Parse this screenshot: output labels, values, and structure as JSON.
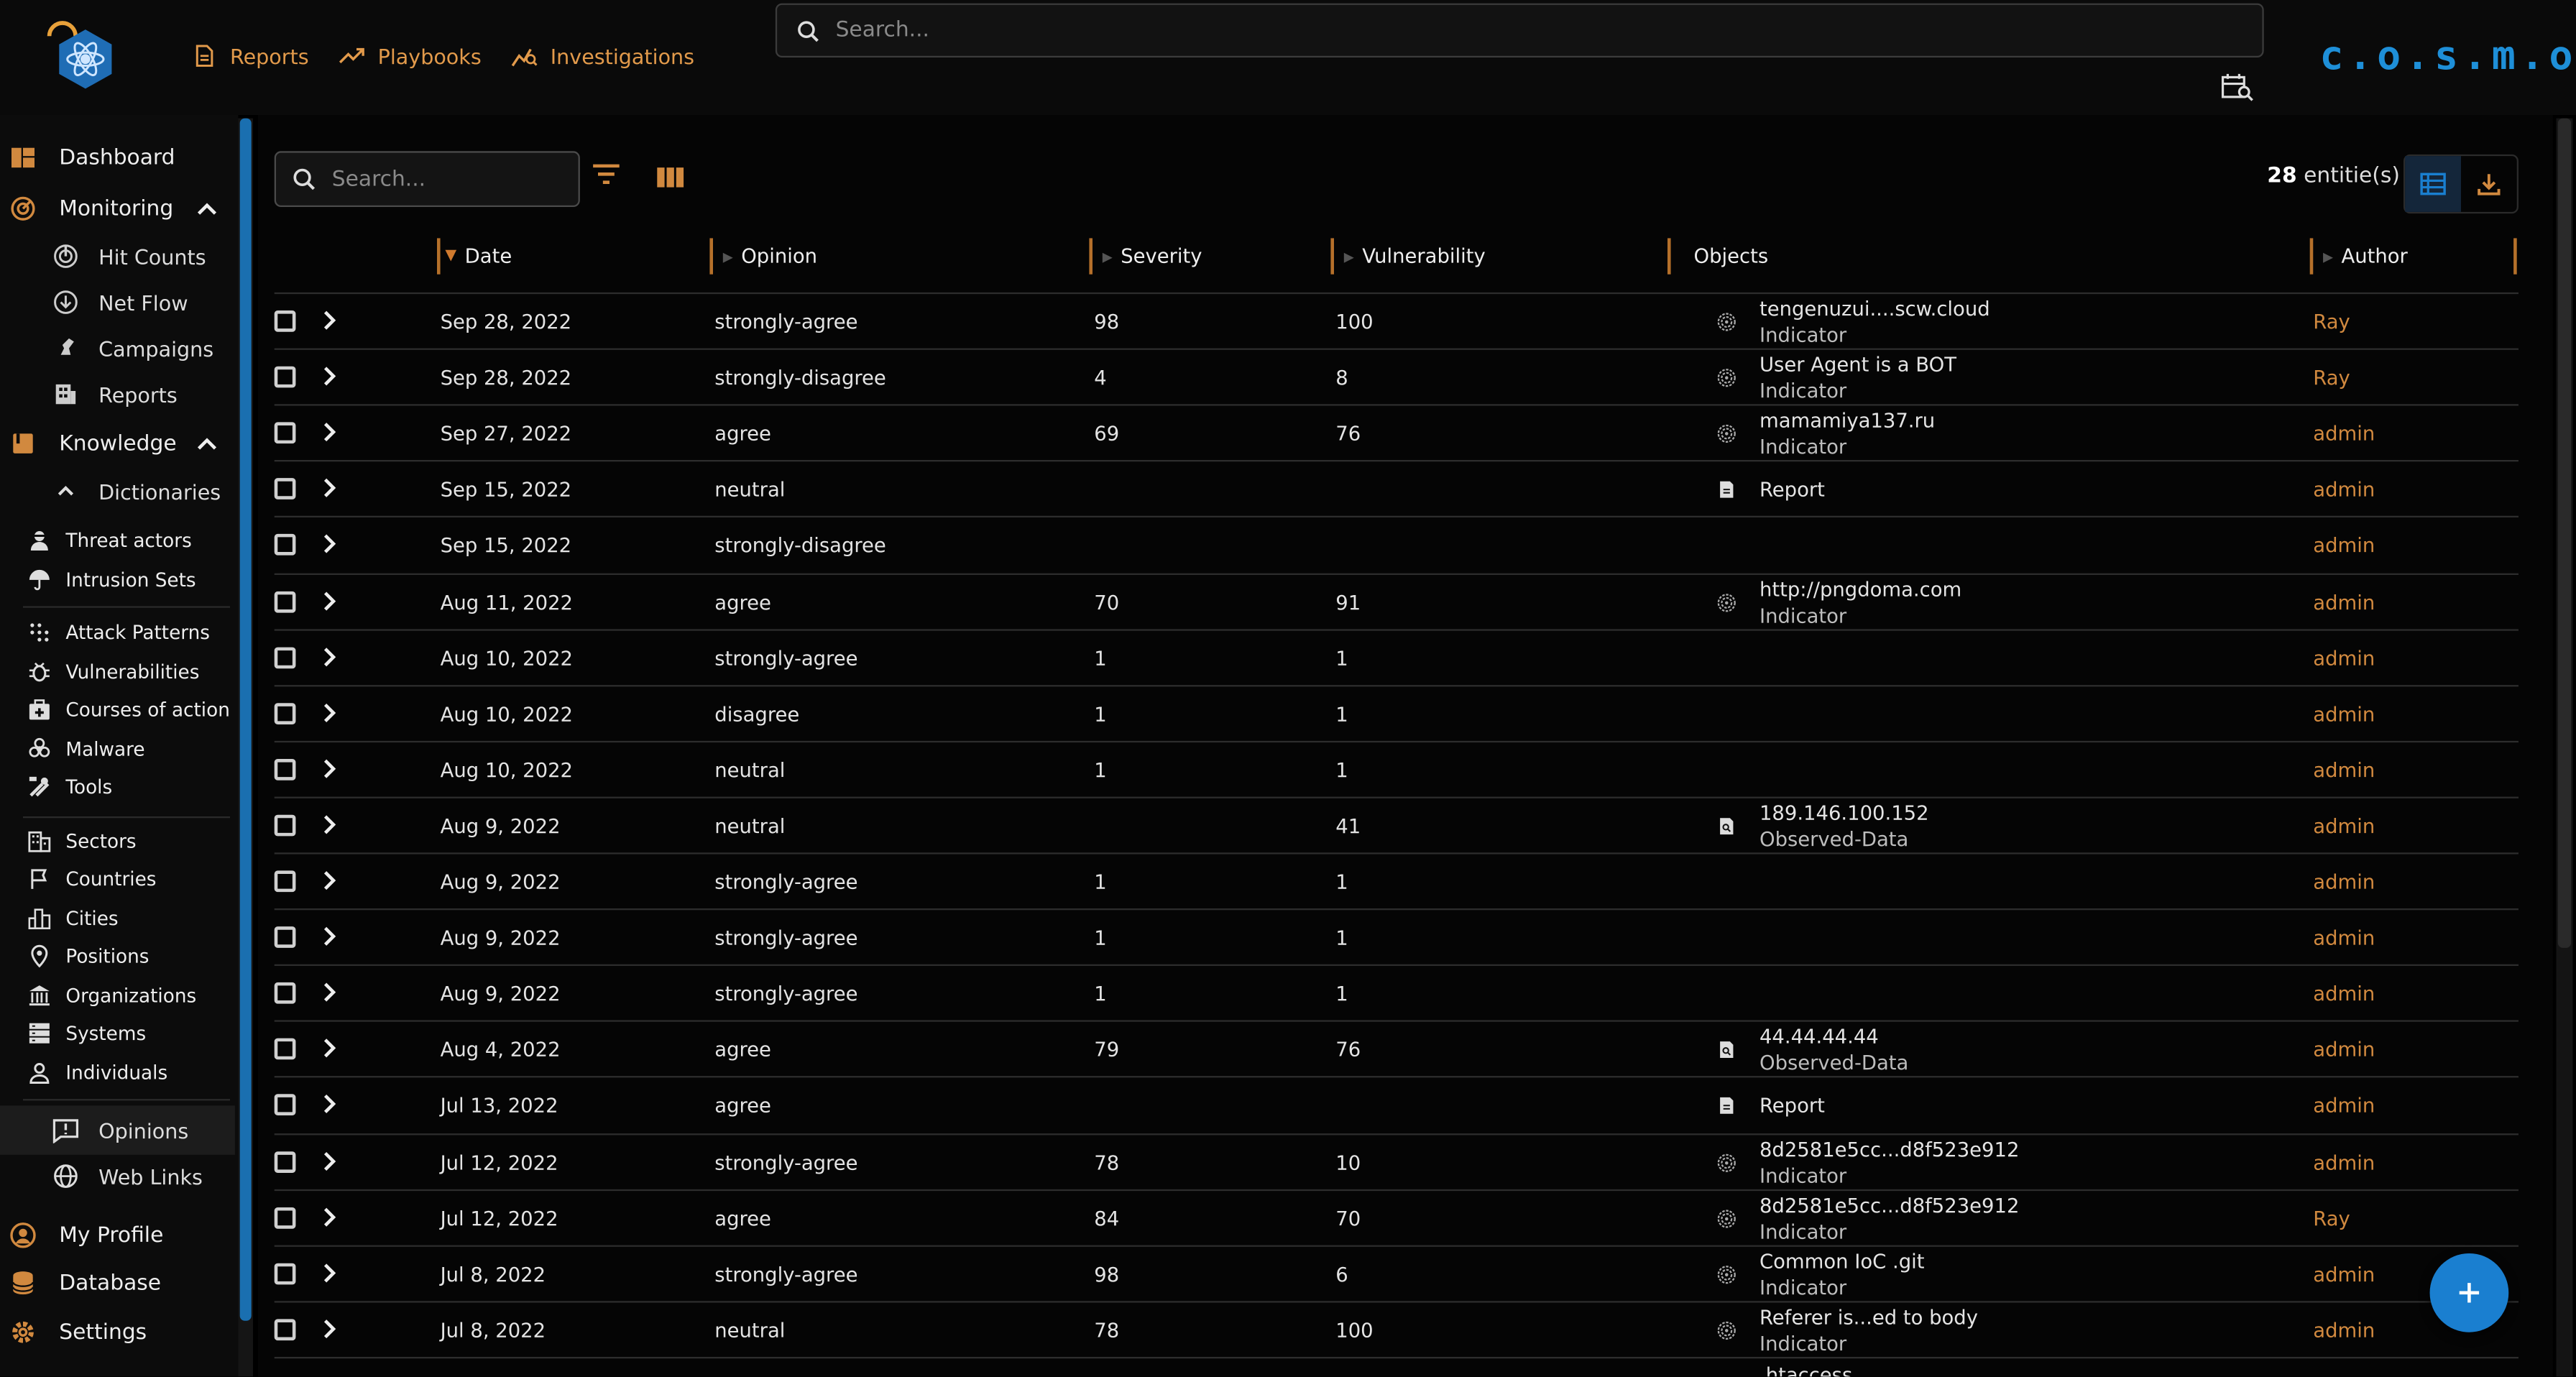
{
  "app": {
    "brand": "c.o.s.m.o",
    "top_nav": [
      {
        "label": "Reports",
        "icon": "file-icon"
      },
      {
        "label": "Playbooks",
        "icon": "trending-icon"
      },
      {
        "label": "Investigations",
        "icon": "investigation-icon"
      }
    ],
    "search_placeholder": "Search..."
  },
  "sidebar": {
    "dashboard": "Dashboard",
    "monitoring": "Monitoring",
    "hit_counts": "Hit Counts",
    "net_flow": "Net Flow",
    "campaigns": "Campaigns",
    "reports": "Reports",
    "knowledge": "Knowledge",
    "dictionaries": "Dictionaries",
    "threat_actors": "Threat actors",
    "intrusion_sets": "Intrusion Sets",
    "attack_patterns": "Attack Patterns",
    "vulnerabilities": "Vulnerabilities",
    "courses_of_action": "Courses of action",
    "malware": "Malware",
    "tools": "Tools",
    "sectors": "Sectors",
    "countries": "Countries",
    "cities": "Cities",
    "positions": "Positions",
    "organizations": "Organizations",
    "systems": "Systems",
    "individuals": "Individuals",
    "opinions": "Opinions",
    "web_links": "Web Links",
    "my_profile": "My Profile",
    "database": "Database",
    "settings": "Settings"
  },
  "toolbar": {
    "search_placeholder": "Search...",
    "count_number": "28",
    "count_suffix": "entitie(s)"
  },
  "columns": {
    "date": "Date",
    "opinion": "Opinion",
    "severity": "Severity",
    "vulnerability": "Vulnerability",
    "objects": "Objects",
    "author": "Author"
  },
  "colors": {
    "accent_orange": "#d1893f",
    "accent_blue": "#1a7fd0"
  },
  "rows": [
    {
      "date": "Sep 28, 2022",
      "opinion": "strongly-agree",
      "severity": "98",
      "vulnerability": "100",
      "obj_icon": "indicator",
      "obj_name": "tengenuzui....scw.cloud",
      "obj_type": "Indicator",
      "author": "Ray"
    },
    {
      "date": "Sep 28, 2022",
      "opinion": "strongly-disagree",
      "severity": "4",
      "vulnerability": "8",
      "obj_icon": "indicator",
      "obj_name": "User Agent is a BOT",
      "obj_type": "Indicator",
      "author": "Ray"
    },
    {
      "date": "Sep 27, 2022",
      "opinion": "agree",
      "severity": "69",
      "vulnerability": "76",
      "obj_icon": "indicator",
      "obj_name": "mamamiya137.ru",
      "obj_type": "Indicator",
      "author": "admin"
    },
    {
      "date": "Sep 15, 2022",
      "opinion": "neutral",
      "severity": "",
      "vulnerability": "",
      "obj_icon": "report",
      "obj_name": "Report",
      "obj_type": "",
      "author": "admin"
    },
    {
      "date": "Sep 15, 2022",
      "opinion": "strongly-disagree",
      "severity": "",
      "vulnerability": "",
      "obj_icon": "",
      "obj_name": "",
      "obj_type": "",
      "author": "admin"
    },
    {
      "date": "Aug 11, 2022",
      "opinion": "agree",
      "severity": "70",
      "vulnerability": "91",
      "obj_icon": "indicator",
      "obj_name": "http://pngdoma.com",
      "obj_type": "Indicator",
      "author": "admin"
    },
    {
      "date": "Aug 10, 2022",
      "opinion": "strongly-agree",
      "severity": "1",
      "vulnerability": "1",
      "obj_icon": "",
      "obj_name": "",
      "obj_type": "",
      "author": "admin"
    },
    {
      "date": "Aug 10, 2022",
      "opinion": "disagree",
      "severity": "1",
      "vulnerability": "1",
      "obj_icon": "",
      "obj_name": "",
      "obj_type": "",
      "author": "admin"
    },
    {
      "date": "Aug 10, 2022",
      "opinion": "neutral",
      "severity": "1",
      "vulnerability": "1",
      "obj_icon": "",
      "obj_name": "",
      "obj_type": "",
      "author": "admin"
    },
    {
      "date": "Aug 9, 2022",
      "opinion": "neutral",
      "severity": "",
      "vulnerability": "41",
      "obj_icon": "observed",
      "obj_name": "189.146.100.152",
      "obj_type": "Observed-Data",
      "author": "admin"
    },
    {
      "date": "Aug 9, 2022",
      "opinion": "strongly-agree",
      "severity": "1",
      "vulnerability": "1",
      "obj_icon": "",
      "obj_name": "",
      "obj_type": "",
      "author": "admin"
    },
    {
      "date": "Aug 9, 2022",
      "opinion": "strongly-agree",
      "severity": "1",
      "vulnerability": "1",
      "obj_icon": "",
      "obj_name": "",
      "obj_type": "",
      "author": "admin"
    },
    {
      "date": "Aug 9, 2022",
      "opinion": "strongly-agree",
      "severity": "1",
      "vulnerability": "1",
      "obj_icon": "",
      "obj_name": "",
      "obj_type": "",
      "author": "admin"
    },
    {
      "date": "Aug 4, 2022",
      "opinion": "agree",
      "severity": "79",
      "vulnerability": "76",
      "obj_icon": "observed",
      "obj_name": "44.44.44.44",
      "obj_type": "Observed-Data",
      "author": "admin"
    },
    {
      "date": "Jul 13, 2022",
      "opinion": "agree",
      "severity": "",
      "vulnerability": "",
      "obj_icon": "report",
      "obj_name": "Report",
      "obj_type": "",
      "author": "admin"
    },
    {
      "date": "Jul 12, 2022",
      "opinion": "strongly-agree",
      "severity": "78",
      "vulnerability": "10",
      "obj_icon": "indicator",
      "obj_name": "8d2581e5cc...d8f523e912",
      "obj_type": "Indicator",
      "author": "admin"
    },
    {
      "date": "Jul 12, 2022",
      "opinion": "agree",
      "severity": "84",
      "vulnerability": "70",
      "obj_icon": "indicator",
      "obj_name": "8d2581e5cc...d8f523e912",
      "obj_type": "Indicator",
      "author": "Ray"
    },
    {
      "date": "Jul 8, 2022",
      "opinion": "strongly-agree",
      "severity": "98",
      "vulnerability": "6",
      "obj_icon": "indicator",
      "obj_name": "Common IoC .git",
      "obj_type": "Indicator",
      "author": "admin"
    },
    {
      "date": "Jul 8, 2022",
      "opinion": "neutral",
      "severity": "78",
      "vulnerability": "100",
      "obj_icon": "indicator",
      "obj_name": "Referer is...ed to body",
      "obj_type": "Indicator",
      "author": "admin"
    },
    {
      "date": "",
      "opinion": "",
      "severity": "",
      "vulnerability": "",
      "obj_icon": "",
      "obj_name": ".htaccess",
      "obj_type": "",
      "author": ""
    }
  ]
}
